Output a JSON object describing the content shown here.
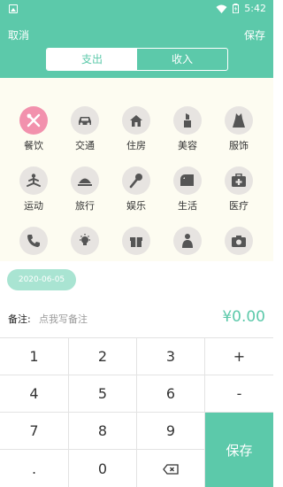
{
  "status": {
    "time": "5:42"
  },
  "header": {
    "cancel": "取消",
    "save": "保存",
    "tabs": [
      {
        "label": "支出",
        "active": true
      },
      {
        "label": "收入",
        "active": false
      }
    ]
  },
  "categories": [
    {
      "label": "餐饮",
      "icon": "cutlery-icon",
      "selected": true
    },
    {
      "label": "交通",
      "icon": "car-icon"
    },
    {
      "label": "住房",
      "icon": "house-icon"
    },
    {
      "label": "美容",
      "icon": "lipstick-icon"
    },
    {
      "label": "服饰",
      "icon": "dress-icon"
    },
    {
      "label": "运动",
      "icon": "yoga-icon"
    },
    {
      "label": "旅行",
      "icon": "travel-icon"
    },
    {
      "label": "娱乐",
      "icon": "microphone-icon"
    },
    {
      "label": "生活",
      "icon": "tissue-icon"
    },
    {
      "label": "医疗",
      "icon": "medkit-icon"
    },
    {
      "label": "",
      "icon": "phone-icon"
    },
    {
      "label": "",
      "icon": "lightbulb-icon"
    },
    {
      "label": "",
      "icon": "gift-icon"
    },
    {
      "label": "",
      "icon": "baby-icon"
    },
    {
      "label": "",
      "icon": "camera-icon"
    }
  ],
  "date": "2020-06-05",
  "note": {
    "label": "备注:",
    "placeholder": "点我写备注"
  },
  "amount": "¥0.00",
  "keypad": {
    "k1": "1",
    "k2": "2",
    "k3": "3",
    "plus": "+",
    "k4": "4",
    "k5": "5",
    "k6": "6",
    "minus": "-",
    "k7": "7",
    "k8": "8",
    "k9": "9",
    "dot": ".",
    "k0": "0",
    "save": "保存"
  },
  "colors": {
    "accent": "#5cc9aa",
    "selected": "#f291ad",
    "icon_bg": "#e7e4e1",
    "panel_bg": "#fdfcf1"
  }
}
